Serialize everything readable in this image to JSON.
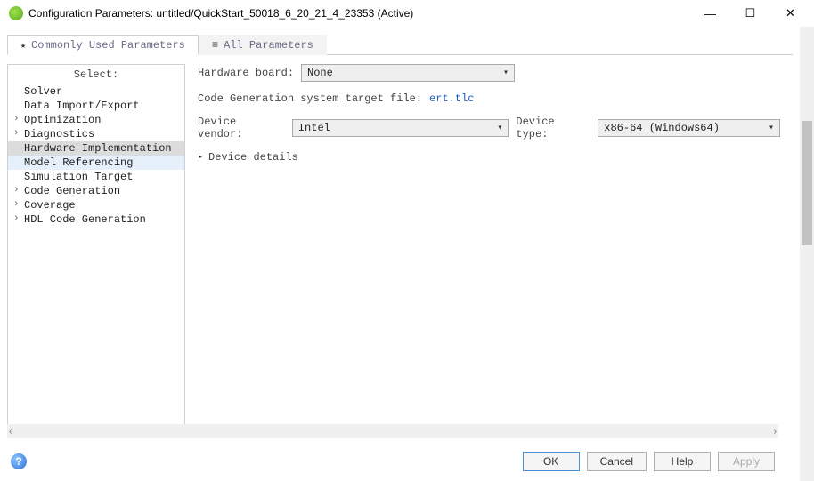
{
  "window": {
    "title": "Configuration Parameters: untitled/QuickStart_50018_6_20_21_4_23353 (Active)"
  },
  "tabs": {
    "commonly_used": "Commonly Used Parameters",
    "all_params": "All Parameters"
  },
  "sidebar": {
    "title": "Select:",
    "items": [
      {
        "label": "Solver",
        "has_children": false
      },
      {
        "label": "Data Import/Export",
        "has_children": false
      },
      {
        "label": "Optimization",
        "has_children": true
      },
      {
        "label": "Diagnostics",
        "has_children": true
      },
      {
        "label": "Hardware Implementation",
        "has_children": false,
        "selected": true
      },
      {
        "label": "Model Referencing",
        "has_children": false,
        "highlight": true
      },
      {
        "label": "Simulation Target",
        "has_children": false
      },
      {
        "label": "Code Generation",
        "has_children": true
      },
      {
        "label": "Coverage",
        "has_children": true
      },
      {
        "label": "HDL Code Generation",
        "has_children": true
      }
    ]
  },
  "main": {
    "hardware_board_label": "Hardware board:",
    "hardware_board_value": "None",
    "codegen_label": "Code Generation system target file:",
    "codegen_value": "ert.tlc",
    "device_vendor_label": "Device vendor:",
    "device_vendor_value": "Intel",
    "device_type_label": "Device type:",
    "device_type_value": "x86-64 (Windows64)",
    "device_details_label": "Device details"
  },
  "footer": {
    "ok": "OK",
    "cancel": "Cancel",
    "help": "Help",
    "apply": "Apply"
  }
}
